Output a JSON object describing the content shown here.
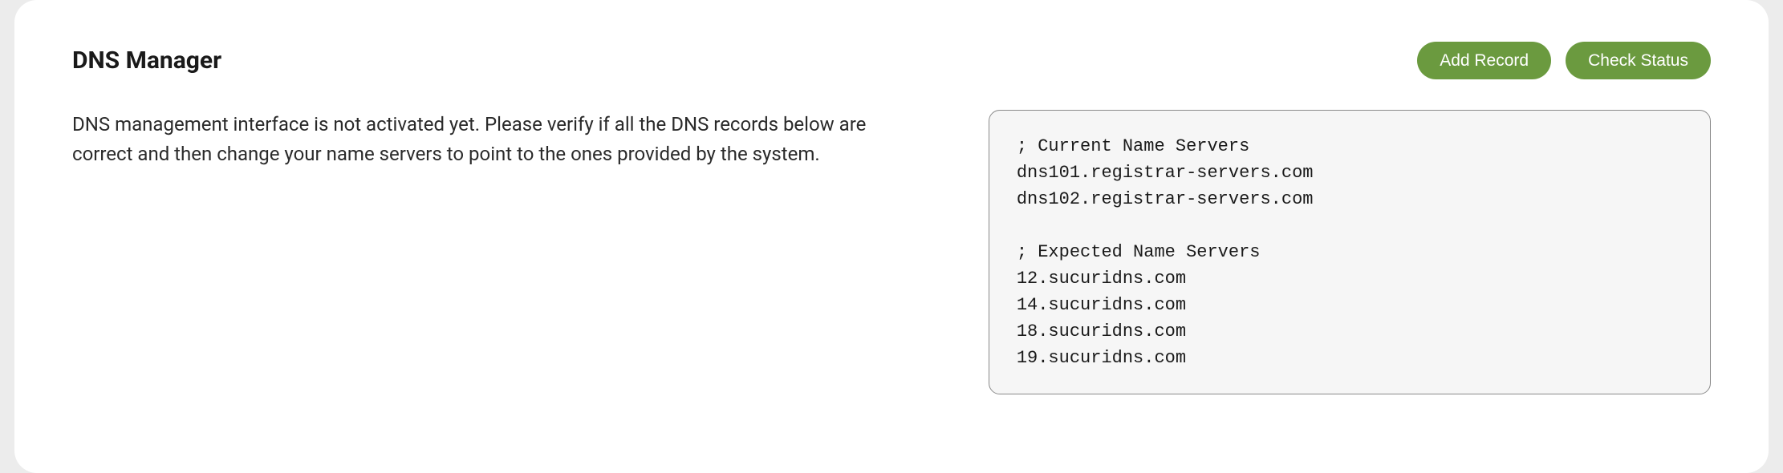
{
  "header": {
    "title": "DNS Manager",
    "buttons": {
      "add_record": "Add Record",
      "check_status": "Check Status"
    }
  },
  "description": "DNS management interface is not activated yet. Please verify if all the DNS records below are correct and then change your name servers to point to the ones provided by the system.",
  "nameservers": {
    "current_comment": "; Current Name Servers",
    "current": [
      "dns101.registrar-servers.com",
      "dns102.registrar-servers.com"
    ],
    "expected_comment": "; Expected Name Servers",
    "expected": [
      "12.sucuridns.com",
      "14.sucuridns.com",
      "18.sucuridns.com",
      "19.sucuridns.com"
    ]
  }
}
